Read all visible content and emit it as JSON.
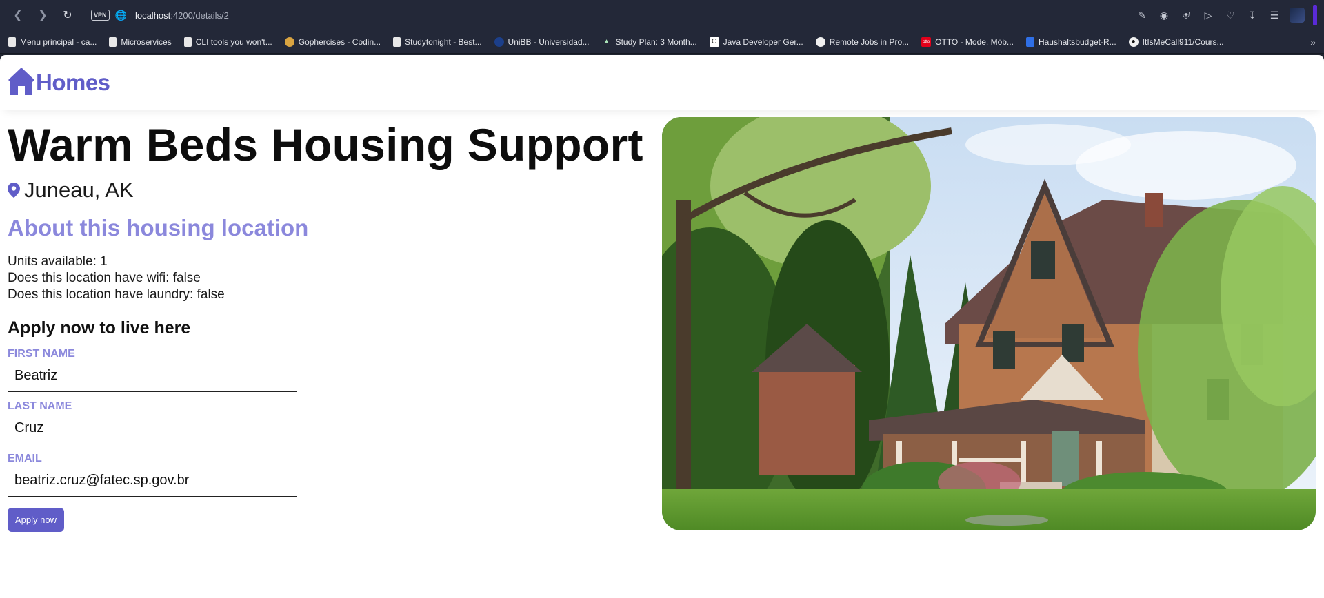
{
  "browser": {
    "url_host": "localhost",
    "url_path": ":4200/details/2",
    "vpn_label": "VPN",
    "bookmarks": [
      {
        "label": "Menu principal - ca...",
        "icon": "page-icon"
      },
      {
        "label": "Microservices",
        "icon": "page-icon"
      },
      {
        "label": "CLI tools you won't...",
        "icon": "page-icon"
      },
      {
        "label": "Gophercises - Codin...",
        "icon": "gopher-icon"
      },
      {
        "label": "Studytonight - Best...",
        "icon": "page-icon"
      },
      {
        "label": "UniBB - Universidad...",
        "icon": "unibb-icon"
      },
      {
        "label": "Study Plan: 3 Month...",
        "icon": "mountain-icon"
      },
      {
        "label": "Java Developer Ger...",
        "icon": "c-icon"
      },
      {
        "label": "Remote Jobs in Pro...",
        "icon": "circle-icon"
      },
      {
        "label": "OTTO - Mode, Möb...",
        "icon": "otto-icon"
      },
      {
        "label": "Haushaltsbudget-R...",
        "icon": "doc-icon"
      },
      {
        "label": "ItIsMeCall911/Cours...",
        "icon": "github-icon"
      }
    ]
  },
  "app": {
    "logo_text": "Homes",
    "accent_color": "#605dc8",
    "light_accent_color": "#8b88dc"
  },
  "listing": {
    "title": "Warm Beds Housing Support",
    "location": "Juneau, AK",
    "about_heading": "About this housing location",
    "units": "Units available: 1",
    "wifi": "Does this location have wifi: false",
    "laundry": "Does this location have laundry: false"
  },
  "form": {
    "heading": "Apply now to live here",
    "first_name_label": "First Name",
    "first_name_value": "Beatriz",
    "last_name_label": "Last Name",
    "last_name_value": "Cruz",
    "email_label": "Email",
    "email_value": "beatriz.cruz@fatec.sp.gov.br",
    "submit_label": "Apply now"
  }
}
